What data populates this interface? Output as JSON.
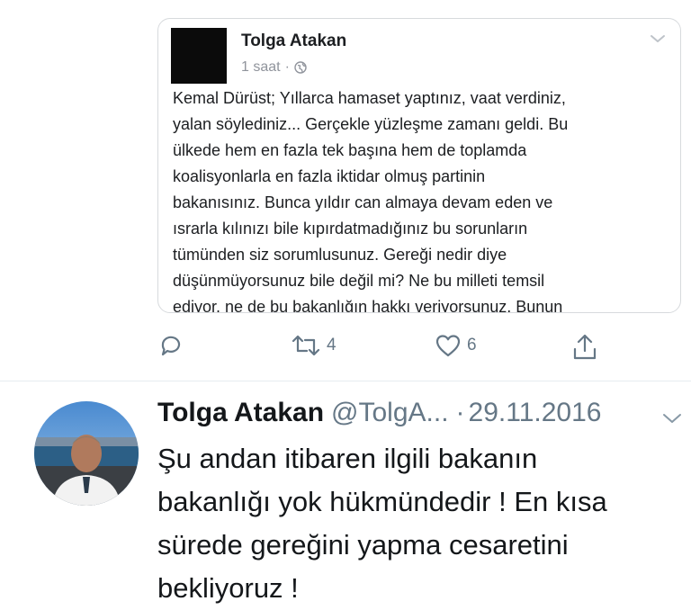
{
  "embedded_post": {
    "author": "Tolga Atakan",
    "time": "1 saat",
    "separator": "·",
    "body": "Kemal Dürüst; Yıllarca hamaset yaptınız, vaat verdiniz,\nyalan söylediniz... Gerçekle yüzleşme zamanı geldi. Bu\nülkede hem en fazla tek başına hem de toplamda\nkoalisyonlarla en fazla iktidar olmuş partinin\nbakanısınız. Bunca yıldır can almaya devam eden ve\nısrarla kılınızı bile kıpırdatmadığınız bu sorunların\ntümünden siz sorumlusunuz. Gereği nedir diye\ndüşünmüyorsunuz bile değil mi? Ne bu milleti temsil\nediyor, ne de bu bakanlığın hakkı veriyorsunuz. Bunun"
  },
  "actions": {
    "reply": {
      "icon": "reply-icon"
    },
    "retweet": {
      "icon": "retweet-icon",
      "count": "4"
    },
    "like": {
      "icon": "heart-icon",
      "count": "6"
    },
    "share": {
      "icon": "share-icon"
    }
  },
  "tweet": {
    "name": "Tolga Atakan",
    "handle": "@TolgA...",
    "separator": "·",
    "date": "29.11.2016",
    "text": "Şu andan itibaren ilgili bakanın\nbakanlığı yok hükmündedir ! En kısa\nsürede gereğini yapma cesaretini\nbekliyoruz !"
  },
  "colors": {
    "secondary_text": "#657786",
    "primary_text": "#14171a",
    "card_border": "#d7dadd"
  }
}
